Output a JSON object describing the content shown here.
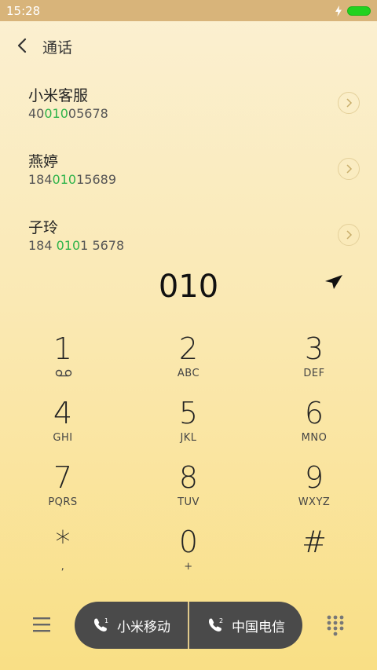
{
  "status": {
    "time": "15:28"
  },
  "header": {
    "title": "通话"
  },
  "contacts": [
    {
      "name": "小米客服",
      "num_pre": "40",
      "num_hl": "010",
      "num_post": "05678"
    },
    {
      "name": "燕婷",
      "num_pre": "184",
      "num_hl": "010",
      "num_post": "15689"
    },
    {
      "name": "子玲",
      "num_pre": "184 ",
      "num_hl": "010",
      "num_post": "1 5678"
    }
  ],
  "typed_number": "010",
  "keypad": [
    {
      "digit": "1",
      "letters": ""
    },
    {
      "digit": "2",
      "letters": "ABC"
    },
    {
      "digit": "3",
      "letters": "DEF"
    },
    {
      "digit": "4",
      "letters": "GHI"
    },
    {
      "digit": "5",
      "letters": "JKL"
    },
    {
      "digit": "6",
      "letters": "MNO"
    },
    {
      "digit": "7",
      "letters": "PQRS"
    },
    {
      "digit": "8",
      "letters": "TUV"
    },
    {
      "digit": "9",
      "letters": "WXYZ"
    },
    {
      "digit": "*",
      "letters": ","
    },
    {
      "digit": "0",
      "letters": "+"
    },
    {
      "digit": "#",
      "letters": ""
    }
  ],
  "call_buttons": {
    "sim1_label": "小米移动",
    "sim2_label": "中国电信"
  },
  "colors": {
    "status_bar": "#d8b47a",
    "highlight": "#2db34a",
    "pill": "#4a4a4a",
    "battery": "#22d21f"
  }
}
